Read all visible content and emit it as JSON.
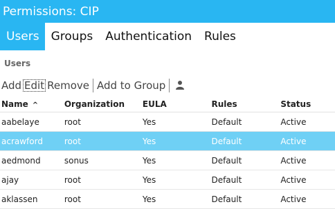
{
  "window": {
    "title": "Permissions: CIP"
  },
  "tabs": [
    {
      "label": "Users",
      "active": true
    },
    {
      "label": "Groups",
      "active": false
    },
    {
      "label": "Authentication",
      "active": false
    },
    {
      "label": "Rules",
      "active": false
    }
  ],
  "section": {
    "label": "Users"
  },
  "toolbar": {
    "add": "Add",
    "edit": "Edit",
    "remove": "Remove",
    "add_to_group": "Add to Group",
    "user_icon": "user-icon"
  },
  "table": {
    "columns": [
      "Name",
      "Organization",
      "EULA",
      "Rules",
      "Status"
    ],
    "sort_indicator": "^",
    "rows": [
      {
        "name": "aabelaye",
        "organization": "root",
        "eula": "Yes",
        "rules": "Default",
        "status": "Active",
        "selected": false
      },
      {
        "name": "acrawford",
        "organization": "root",
        "eula": "Yes",
        "rules": "Default",
        "status": "Active",
        "selected": true
      },
      {
        "name": "aedmond",
        "organization": "sonus",
        "eula": "Yes",
        "rules": "Default",
        "status": "Active",
        "selected": false
      },
      {
        "name": "ajay",
        "organization": "root",
        "eula": "Yes",
        "rules": "Default",
        "status": "Active",
        "selected": false
      },
      {
        "name": "aklassen",
        "organization": "root",
        "eula": "Yes",
        "rules": "Default",
        "status": "Active",
        "selected": false
      }
    ]
  },
  "colors": {
    "accent": "#29b6f2",
    "selected_row": "#6fd0f5"
  }
}
